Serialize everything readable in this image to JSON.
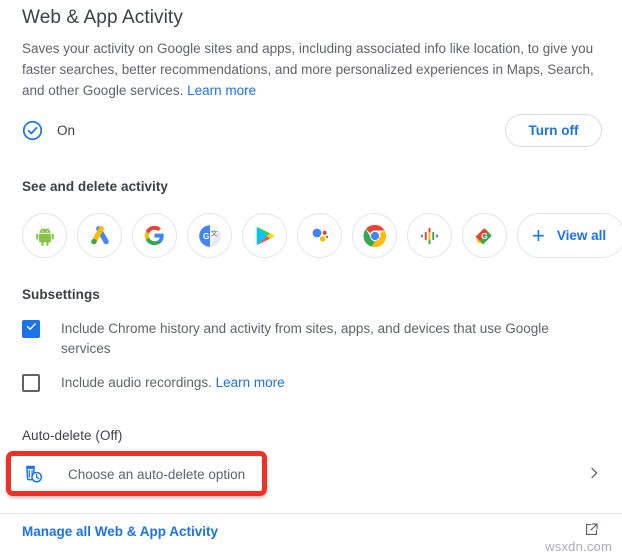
{
  "header": {
    "title": "Web & App Activity",
    "description": "Saves your activity on Google sites and apps, including associated info like location, to give you faster searches, better recommendations, and more personalized experiences in Maps, Search, and other Google services.",
    "description_link": "Learn more"
  },
  "status": {
    "label": "On",
    "icon": "check-circle-icon",
    "toggle_button": "Turn off",
    "accent_color": "#1a73e8"
  },
  "see_and_delete": {
    "heading": "See and delete activity",
    "apps": [
      {
        "name": "android",
        "label": "Android"
      },
      {
        "name": "google-ads",
        "label": "Google Ads"
      },
      {
        "name": "google-search",
        "label": "Google"
      },
      {
        "name": "google-translate",
        "label": "Google Translate"
      },
      {
        "name": "google-play",
        "label": "Google Play"
      },
      {
        "name": "google-assistant",
        "label": "Google Assistant"
      },
      {
        "name": "google-chrome",
        "label": "Chrome"
      },
      {
        "name": "google-podcasts",
        "label": "Google Podcasts"
      },
      {
        "name": "google-shopping",
        "label": "Google Shopping"
      }
    ],
    "view_all_label": "View all",
    "view_all_icon": "plus-icon"
  },
  "subsettings": {
    "heading": "Subsettings",
    "items": [
      {
        "checked": true,
        "label": "Include Chrome history and activity from sites, apps, and devices that use Google services",
        "link": ""
      },
      {
        "checked": false,
        "label": "Include audio recordings.",
        "link": "Learn more"
      }
    ]
  },
  "auto_delete": {
    "heading": "Auto-delete (Off)",
    "option_label": "Choose an auto-delete option",
    "icon": "trash-clock-icon",
    "chevron": "chevron-right-icon",
    "highlight_color": "#ee3124"
  },
  "footer": {
    "manage_link": "Manage all Web & App Activity",
    "external_icon": "open-in-new-icon"
  },
  "watermark": "wsxdn.com"
}
